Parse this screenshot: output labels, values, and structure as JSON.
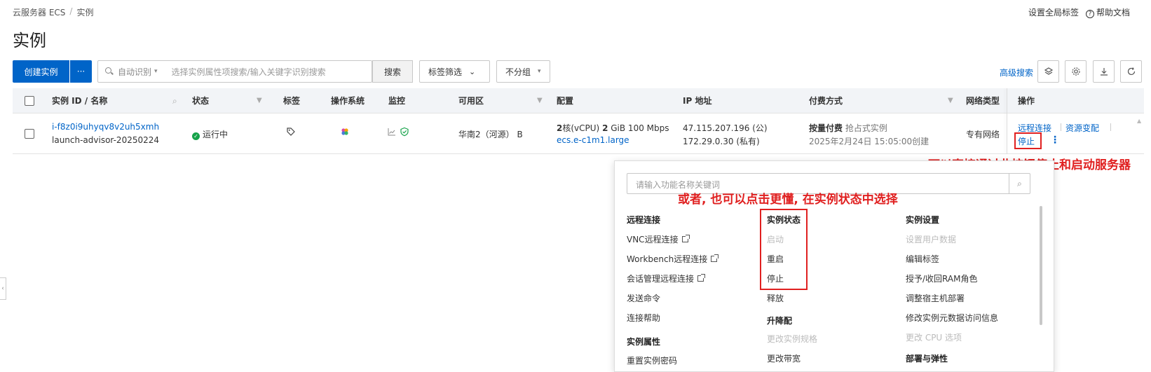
{
  "breadcrumb": {
    "root": "云服务器 ECS",
    "separator": "/",
    "current": "实例"
  },
  "header": {
    "global_tags": "设置全局标签",
    "help_docs": "帮助文档",
    "help_icon_glyph": "?"
  },
  "page_title": "实例",
  "toolbar": {
    "create_label": "创建实例",
    "more_label": "···",
    "search_mode": "自动识别",
    "search_placeholder": "选择实例属性项搜索/输入关键字识别搜索",
    "search_button": "搜索",
    "tag_filter": "标签筛选",
    "group_select": "不分组",
    "advanced_search": "高级搜索"
  },
  "table": {
    "columns": {
      "instance": "实例 ID / 名称",
      "status": "状态",
      "tags": "标签",
      "os": "操作系统",
      "monitor": "监控",
      "zone": "可用区",
      "config": "配置",
      "ip": "IP 地址",
      "billing": "付费方式",
      "network": "网络类型",
      "actions": "操作"
    },
    "rows": [
      {
        "id": "i-f8z0i9uhyqv8v2uh5xmh",
        "name": "launch-advisor-20250224",
        "status": "运行中",
        "zone": "华南2（河源） B",
        "cpu_bold": "2",
        "cpu_unit": "核(vCPU)",
        "mem_bold": "2",
        "mem_unit": "GiB 100 Mbps",
        "instance_type": "ecs.e-c1m1.large",
        "public_ip": "47.115.207.196 (公)",
        "private_ip": "172.29.0.30 (私有)",
        "billing": "按量付费",
        "billing_sub": "抢占式实例",
        "created": "2025年2月24日 15:05:00创建",
        "network": "专有网络",
        "actions": {
          "remote": "远程连接",
          "resize": "资源变配",
          "stop": "停止",
          "more": "⋮"
        }
      }
    ]
  },
  "annotations": {
    "stop_hint": "可以直接通过此按钮停止和启动服务器",
    "menu_hint": "或者, 也可以点击更懂, 在实例状态中选择"
  },
  "dropdown": {
    "search_placeholder": "请输入功能名称关键词",
    "col1": {
      "remote_head": "远程连接",
      "vnc": "VNC远程连接",
      "workbench": "Workbench远程连接",
      "session": "会话管理远程连接",
      "send_cmd": "发送命令",
      "help": "连接帮助",
      "attr_head": "实例属性",
      "reset_pwd": "重置实例密码"
    },
    "col2": {
      "state_head": "实例状态",
      "start": "启动",
      "restart": "重启",
      "stop": "停止",
      "release": "释放",
      "upgrade_head": "升降配",
      "change_spec": "更改实例规格",
      "change_bw": "更改带宽"
    },
    "col3": {
      "settings_head": "实例设置",
      "user_data": "设置用户数据",
      "edit_tags": "编辑标签",
      "ram_role": "授予/收回RAM角色",
      "host_deploy": "调整宿主机部署",
      "metadata": "修改实例元数据访问信息",
      "cpu_opt": "更改 CPU 选项",
      "deploy_head": "部署与弹性"
    }
  },
  "colors": {
    "primary": "#0064c8",
    "annotation": "#e02020",
    "running": "#16a34a"
  }
}
